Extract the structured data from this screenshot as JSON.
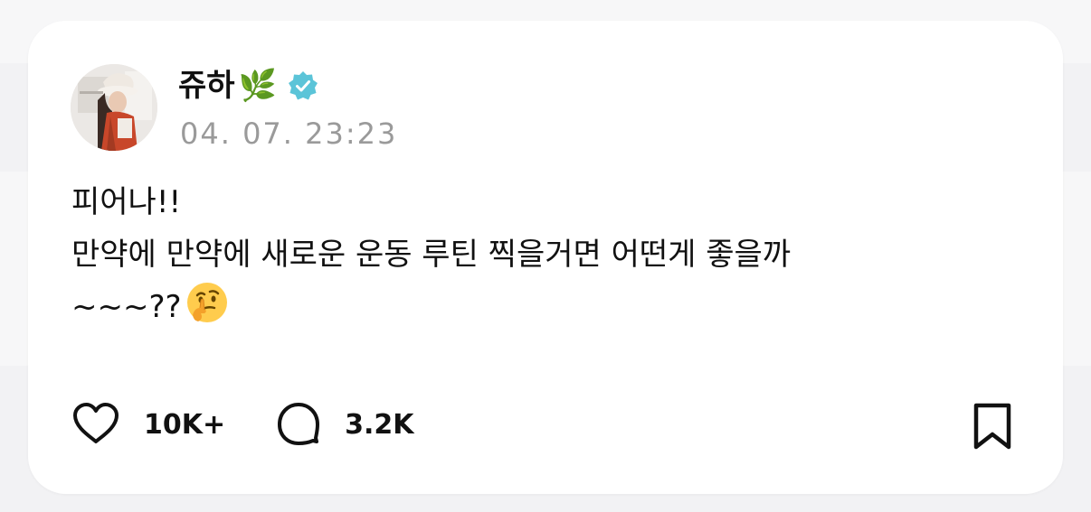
{
  "post": {
    "author_name": "쥬하",
    "author_emoji": "🌿",
    "verified_icon": "verified-badge-icon",
    "timestamp": "04. 07. 23:23",
    "lines": [
      "피어나!!",
      "만약에 만약에 새로운 운동 루틴 찍을거면 어떤게 좋을까",
      "~~~??"
    ],
    "line3_emoji": "thinking-face-icon"
  },
  "actions": {
    "like_icon": "heart-icon",
    "like_count": "10K+",
    "comment_icon": "comment-bubble-icon",
    "comment_count": "3.2K",
    "bookmark_icon": "bookmark-icon"
  },
  "colors": {
    "verified_badge": "#5bc4d8",
    "timestamp_text": "#9a9a9a",
    "page_background": "#f2f2f4",
    "card_background": "#ffffff"
  }
}
